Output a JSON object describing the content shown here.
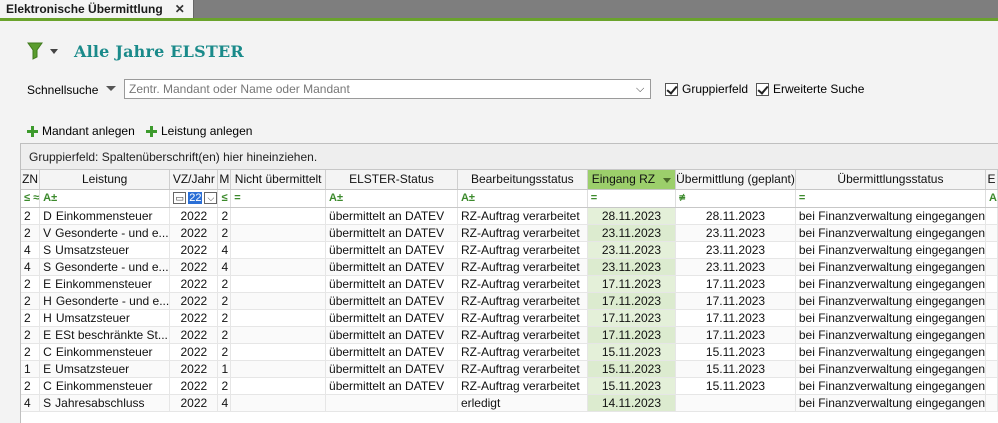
{
  "tab": {
    "title": "Elektronische Übermittlung",
    "close": "✕"
  },
  "header": {
    "title": "Alle Jahre ELSTER"
  },
  "quicksearch": {
    "label": "Schnellsuche",
    "placeholder": "Zentr. Mandant oder Name oder Mandant",
    "value": ""
  },
  "checkboxes": {
    "gruppierfeld": {
      "label": "Gruppierfeld",
      "checked": true
    },
    "erweitert": {
      "label": "Erweiterte Suche",
      "checked": true
    }
  },
  "actions": {
    "mandant": "Mandant anlegen",
    "leistung": "Leistung anlegen"
  },
  "grid": {
    "group_hint": "Gruppierfeld: Spaltenüberschrift(en) hier hineinziehen.",
    "columns": [
      "ZN",
      "Leistung",
      "VZ/Jahr",
      "M",
      "Nicht übermittelt",
      "ELSTER-Status",
      "Bearbeitungsstatus",
      "Eingang RZ",
      "Übermittlung (geplant)",
      "Übermittlungsstatus",
      "E"
    ],
    "filter_row": {
      "zn": "≤ ≈",
      "leistung": "A±",
      "year_value": "22",
      "year_dd": "⌵",
      "m": "≤",
      "nicht": "=",
      "elster": "A±",
      "bearb": "A±",
      "eingang": "=",
      "uebermittlung": "≠",
      "status": "=",
      "e": "A"
    },
    "rows": [
      [
        "2",
        "D",
        "Einkommensteuer",
        "2022",
        "2",
        "übermittelt an DATEV",
        "RZ-Auftrag verarbeitet",
        "28.11.2023",
        "28.11.2023",
        "bei Finanzverwaltung eingegangen"
      ],
      [
        "2",
        "V",
        "Gesonderte - und e...",
        "2022",
        "2",
        "übermittelt an DATEV",
        "RZ-Auftrag verarbeitet",
        "23.11.2023",
        "23.11.2023",
        "bei Finanzverwaltung eingegangen"
      ],
      [
        "4",
        "S",
        "Umsatzsteuer",
        "2022",
        "4",
        "übermittelt an DATEV",
        "RZ-Auftrag verarbeitet",
        "23.11.2023",
        "23.11.2023",
        "bei Finanzverwaltung eingegangen"
      ],
      [
        "4",
        "S",
        "Gesonderte - und e...",
        "2022",
        "4",
        "übermittelt an DATEV",
        "RZ-Auftrag verarbeitet",
        "23.11.2023",
        "23.11.2023",
        "bei Finanzverwaltung eingegangen"
      ],
      [
        "2",
        "E",
        "Einkommensteuer",
        "2022",
        "2",
        "übermittelt an DATEV",
        "RZ-Auftrag verarbeitet",
        "17.11.2023",
        "17.11.2023",
        "bei Finanzverwaltung eingegangen"
      ],
      [
        "2",
        "H",
        "Gesonderte - und e...",
        "2022",
        "2",
        "übermittelt an DATEV",
        "RZ-Auftrag verarbeitet",
        "17.11.2023",
        "17.11.2023",
        "bei Finanzverwaltung eingegangen"
      ],
      [
        "2",
        "H",
        "Umsatzsteuer",
        "2022",
        "2",
        "übermittelt an DATEV",
        "RZ-Auftrag verarbeitet",
        "17.11.2023",
        "17.11.2023",
        "bei Finanzverwaltung eingegangen"
      ],
      [
        "2",
        "E",
        "ESt beschränkte St...",
        "2022",
        "2",
        "übermittelt an DATEV",
        "RZ-Auftrag verarbeitet",
        "17.11.2023",
        "17.11.2023",
        "bei Finanzverwaltung eingegangen"
      ],
      [
        "2",
        "C",
        "Einkommensteuer",
        "2022",
        "2",
        "übermittelt an DATEV",
        "RZ-Auftrag verarbeitet",
        "15.11.2023",
        "15.11.2023",
        "bei Finanzverwaltung eingegangen"
      ],
      [
        "1",
        "E",
        "Umsatzsteuer",
        "2022",
        "1",
        "übermittelt an DATEV",
        "RZ-Auftrag verarbeitet",
        "15.11.2023",
        "15.11.2023",
        "bei Finanzverwaltung eingegangen"
      ],
      [
        "2",
        "C",
        "Einkommensteuer",
        "2022",
        "2",
        "übermittelt an DATEV",
        "RZ-Auftrag verarbeitet",
        "15.11.2023",
        "15.11.2023",
        "bei Finanzverwaltung eingegangen"
      ],
      [
        "4",
        "S",
        "Jahresabschluss",
        "2022",
        "4",
        "",
        "erledigt",
        "14.11.2023",
        "",
        "bei Finanzverwaltung eingegangen"
      ]
    ]
  },
  "colors": {
    "accent_green": "#6aa32c",
    "sorted_header": "#9ccf6b",
    "title_teal": "#1a8a8a"
  }
}
